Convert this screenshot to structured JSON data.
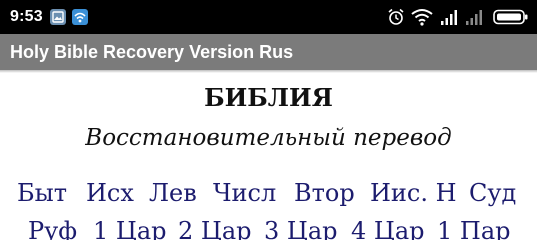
{
  "status_bar": {
    "time": "9:53",
    "icons": [
      "image-notification-icon",
      "wifi-notification-icon",
      "alarm-icon",
      "wifi-signal-icon",
      "cell-signal-icon",
      "cell-signal-weak-icon",
      "battery-icon"
    ]
  },
  "app_bar": {
    "title": "Holy Bible Recovery Version Rus",
    "background": "#7b7b7b"
  },
  "content": {
    "heading": "БИБЛИЯ",
    "subheading": "Восстановительный перевод",
    "link_color": "#1c1c6e",
    "books_row1": [
      "Быт",
      "Исх",
      "Лев",
      "Числ",
      "Втор",
      "Иис. Н",
      "Суд"
    ],
    "books_row2": [
      "Руф",
      "1 Цар",
      "2 Цар",
      "3 Цар",
      "4 Цар",
      "1 Пар"
    ]
  }
}
